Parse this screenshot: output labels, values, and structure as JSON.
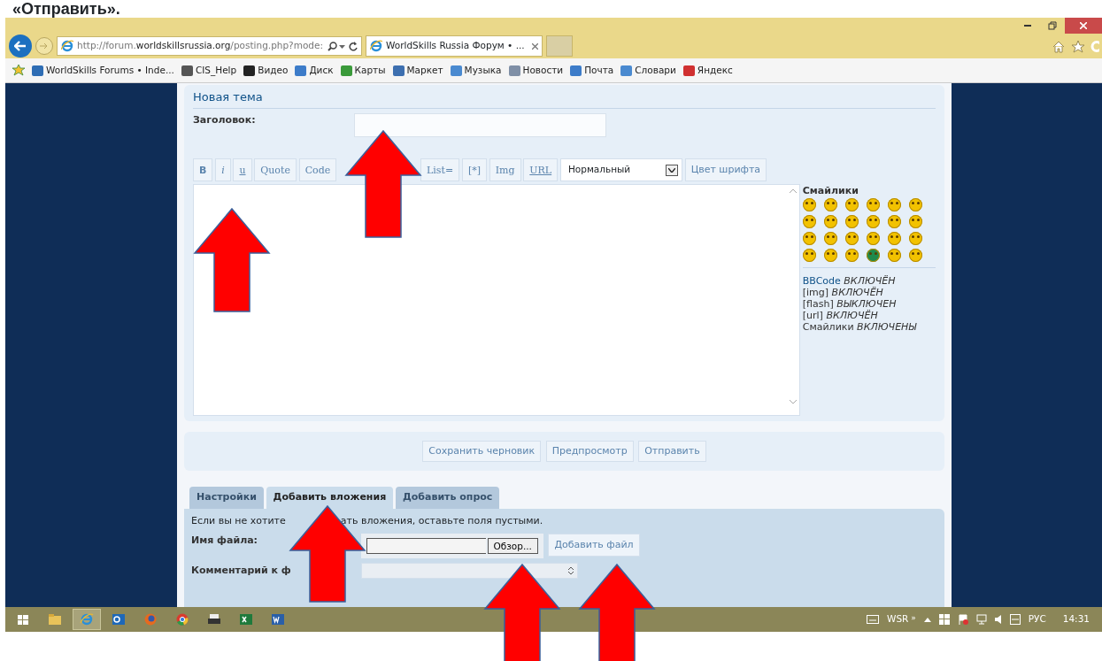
{
  "doc_heading": "«Отправить».",
  "browser": {
    "address": {
      "plain_start": "http://forum.",
      "host": "worldskillsrussia.org",
      "plain_end": "/posting.php?mode:"
    },
    "tab": {
      "title": "WorldSkills Russia Форум • ...",
      "selected": true
    },
    "favorites": [
      {
        "label": "WorldSkills Forums • Inde...",
        "color": "#2e6db4"
      },
      {
        "label": "CIS_Help",
        "color": "#555555"
      },
      {
        "label": "Видео",
        "color": "#222222"
      },
      {
        "label": "Диск",
        "color": "#3d7cc9"
      },
      {
        "label": "Карты",
        "color": "#3a9a3a"
      },
      {
        "label": "Маркет",
        "color": "#3d6fb0"
      },
      {
        "label": "Музыка",
        "color": "#4a8ad0"
      },
      {
        "label": "Новости",
        "color": "#7f8fa6"
      },
      {
        "label": "Почта",
        "color": "#3d7cc9"
      },
      {
        "label": "Словари",
        "color": "#4a8ad0"
      },
      {
        "label": "Яндекс",
        "color": "#d03030"
      }
    ]
  },
  "post": {
    "section_title": "Новая тема",
    "subject_label": "Заголовок:",
    "toolbar": [
      {
        "label": "B",
        "kind": "bold"
      },
      {
        "label": "i",
        "kind": "italic"
      },
      {
        "label": "u",
        "kind": "underline"
      },
      {
        "label": "Quote",
        "kind": "plain"
      },
      {
        "label": "Code",
        "kind": "plain"
      },
      {
        "label": "List=",
        "kind": "plain"
      },
      {
        "label": "[*]",
        "kind": "plain"
      },
      {
        "label": "Img",
        "kind": "plain"
      },
      {
        "label": "URL",
        "kind": "link"
      }
    ],
    "font_size": "Нормальный",
    "font_color": "Цвет шрифта",
    "smilies": {
      "title": "Смайлики",
      "items": [
        {
          "color": "#f2c200"
        },
        {
          "color": "#f2c200"
        },
        {
          "color": "#f2c200"
        },
        {
          "color": "#f2c200"
        },
        {
          "color": "#f2c200"
        },
        {
          "color": "#f2c200"
        },
        {
          "color": "#f2c200"
        },
        {
          "color": "#f2c200"
        },
        {
          "color": "#f2c200"
        },
        {
          "color": "#f2c200"
        },
        {
          "color": "#f2c200"
        },
        {
          "color": "#f2c200"
        },
        {
          "color": "#f2c200"
        },
        {
          "color": "#f2c200"
        },
        {
          "color": "#f2c200"
        },
        {
          "color": "#f2c200"
        },
        {
          "color": "#f2c200"
        },
        {
          "color": "#f2c200"
        },
        {
          "color": "#f2c200"
        },
        {
          "color": "#f2c200"
        },
        {
          "color": "#f2c200"
        },
        {
          "color": "#1f8a4c"
        },
        {
          "color": "#f2c200"
        },
        {
          "color": "#f2c200"
        }
      ]
    },
    "options": [
      {
        "label": "BBCode",
        "value": "ВКЛЮЧЁН",
        "kind": "link"
      },
      {
        "label": "[img]",
        "value": "ВКЛЮЧЁН",
        "kind": "plain"
      },
      {
        "label": "[flash]",
        "value": "ВЫКЛЮЧЕН",
        "kind": "plain"
      },
      {
        "label": "[url]",
        "value": "ВКЛЮЧЁН",
        "kind": "plain"
      },
      {
        "label": "Смайлики",
        "value": "ВКЛЮЧЕНЫ",
        "kind": "plain"
      }
    ],
    "actions": [
      "Сохранить черновик",
      "Предпросмотр",
      "Отправить"
    ]
  },
  "tabs": [
    {
      "label": "Настройки",
      "selected": false
    },
    {
      "label": "Добавить вложения",
      "selected": true
    },
    {
      "label": "Добавить опрос",
      "selected": false
    }
  ],
  "attach": {
    "hint_start": "Если вы не хотите",
    "hint_end": "ать вложения, оставьте поля пустыми.",
    "file_label": "Имя файла:",
    "browse": "Обзор...",
    "add": "Добавить файл",
    "comment_label": "Комментарий к ф"
  },
  "taskbar": {
    "apps": [
      {
        "kind": "start",
        "selected": false
      },
      {
        "kind": "folder",
        "selected": false
      },
      {
        "kind": "browser",
        "selected": true
      },
      {
        "kind": "mail",
        "selected": false
      },
      {
        "kind": "fox",
        "selected": false
      },
      {
        "kind": "chrome",
        "selected": false
      },
      {
        "kind": "printer",
        "selected": false
      },
      {
        "kind": "sheet",
        "selected": false
      },
      {
        "kind": "doc",
        "selected": false
      }
    ],
    "toolbar_label": "WSR",
    "more": "»",
    "language": "РУС",
    "time": "14:31"
  }
}
